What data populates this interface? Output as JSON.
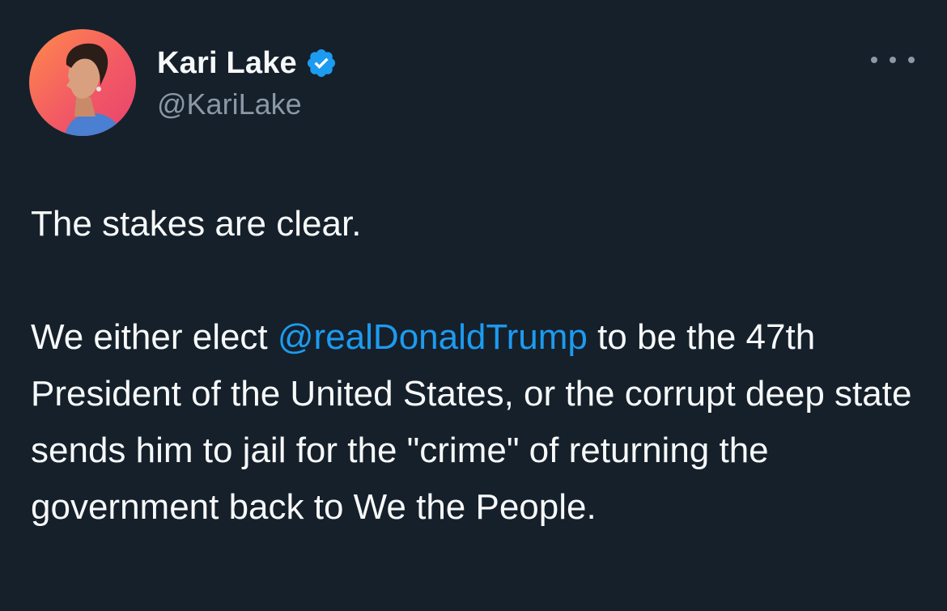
{
  "author": {
    "display_name": "Kari Lake",
    "handle": "@KariLake",
    "verified_icon": "verified-badge-icon"
  },
  "menu": {
    "icon": "more-options-icon"
  },
  "tweet": {
    "line1": "The stakes are clear.",
    "para2_before": "We either elect ",
    "mention": "@realDonaldTrump",
    "para2_after": " to be the 47th President of the United States, or the corrupt deep state sends him to jail for the \"crime\" of returning the government back to We the People."
  },
  "colors": {
    "background": "#15202b",
    "text": "#f7f9f9",
    "secondary": "#8b98a5",
    "accent": "#1d9bf0"
  }
}
